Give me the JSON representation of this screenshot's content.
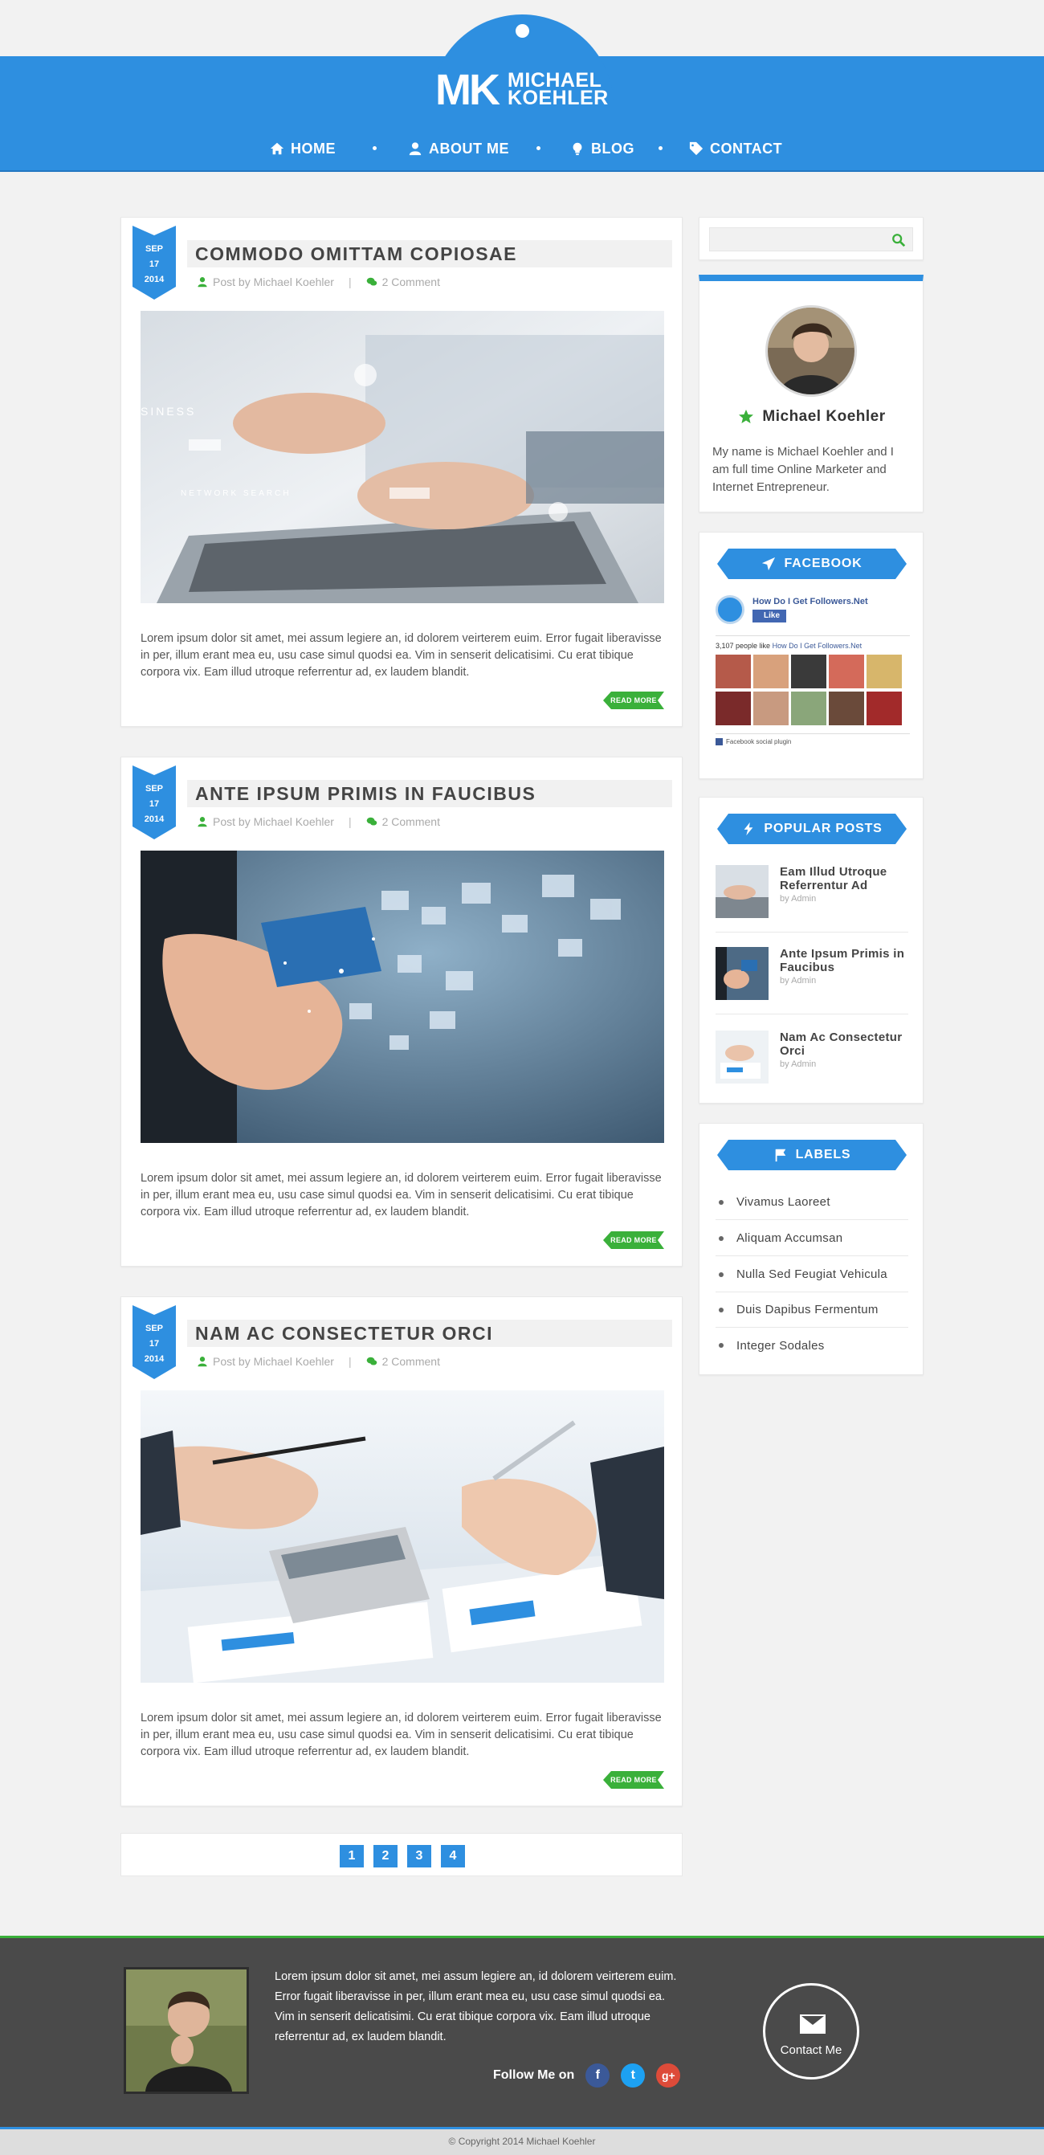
{
  "brand": {
    "monogram": "MK",
    "first_name": "MICHAEL",
    "last_name": "KOEHLER",
    "accent_color": "#2e8fe0",
    "green_color": "#3ab03a"
  },
  "nav": {
    "items": [
      {
        "label": "HOME",
        "icon": "home-icon"
      },
      {
        "label": "ABOUT ME",
        "icon": "user-icon"
      },
      {
        "label": "BLOG",
        "icon": "lightbulb-icon"
      },
      {
        "label": "CONTACT",
        "icon": "tag-icon"
      }
    ]
  },
  "posts": [
    {
      "month": "SEP",
      "day": "17",
      "year": "2014",
      "title": "COMMODO OMITTAM COPIOSAE",
      "author": "Post by Michael Koehler",
      "comments": "2 Comment",
      "excerpt": "Lorem ipsum dolor sit amet, mei assum legiere an, id dolorem veirterem euim. Error fugait liberavisse in per, illum erant mea eu, usu case simul quodsi ea. Vim in senserit delicatisimi. Cu erat tibique corpora vix. Eam illud utroque referrentur ad, ex laudem blandit.",
      "read_more": "READ MORE",
      "image": "laptop-typing-photo"
    },
    {
      "month": "SEP",
      "day": "17",
      "year": "2014",
      "title": "ANTE IPSUM PRIMIS IN FAUCIBUS",
      "author": "Post by Michael Koehler",
      "comments": "2 Comment",
      "excerpt": "Lorem ipsum dolor sit amet, mei assum legiere an, id dolorem veirterem euim. Error fugait liberavisse in per, illum erant mea eu, usu case simul quodsi ea. Vim in senserit delicatisimi. Cu erat tibique corpora vix. Eam illud utroque referrentur ad, ex laudem blandit.",
      "read_more": "READ MORE",
      "image": "floating-screens-hand-photo"
    },
    {
      "month": "SEP",
      "day": "17",
      "year": "2014",
      "title": "NAM AC CONSECTETUR ORCI",
      "author": "Post by Michael Koehler",
      "comments": "2 Comment",
      "excerpt": "Lorem ipsum dolor sit amet, mei assum legiere an, id dolorem veirterem euim. Error fugait liberavisse in per, illum erant mea eu, usu case simul quodsi ea. Vim in senserit delicatisimi. Cu erat tibique corpora vix. Eam illud utroque referrentur ad, ex laudem blandit.",
      "read_more": "READ MORE",
      "image": "calculator-documents-photo"
    }
  ],
  "pagination": {
    "pages": [
      "1",
      "2",
      "3",
      "4"
    ]
  },
  "sidebar": {
    "search": {
      "placeholder": ""
    },
    "profile": {
      "name": "Michael Koehler",
      "bio": "My name is Michael Koehler and I am full time Online Marketer and Internet Entrepreneur."
    },
    "facebook": {
      "heading": "FACEBOOK",
      "page_name": "How Do I Get Followers.Net",
      "like_label": "Like",
      "people_text": "3,107 people like",
      "people_link": "How Do I Get Followers.Net",
      "plugin_label": "Facebook social plugin"
    },
    "popular": {
      "heading": "POPULAR POSTS",
      "items": [
        {
          "title": "Eam Illud Utroque Referrentur Ad",
          "by": "by Admin"
        },
        {
          "title": "Ante Ipsum Primis in Faucibus",
          "by": "by Admin"
        },
        {
          "title": "Nam Ac Consectetur Orci",
          "by": "by Admin"
        }
      ]
    },
    "labels": {
      "heading": "LABELS",
      "items": [
        "Vivamus Laoreet",
        "Aliquam Accumsan",
        "Nulla Sed Feugiat Vehicula",
        "Duis Dapibus Fermentum",
        "Integer Sodales"
      ]
    }
  },
  "footer": {
    "text": "Lorem ipsum dolor sit amet, mei assum legiere an, id dolorem veirterem euim. Error fugait liberavisse in per, illum erant mea eu, usu case simul quodsi ea. Vim in senserit delicatisimi. Cu erat tibique corpora vix. Eam illud utroque referrentur ad, ex laudem blandit.",
    "follow_label": "Follow Me on",
    "contact_label": "Contact Me",
    "copyright": "© Copyright 2014 Michael Koehler"
  }
}
